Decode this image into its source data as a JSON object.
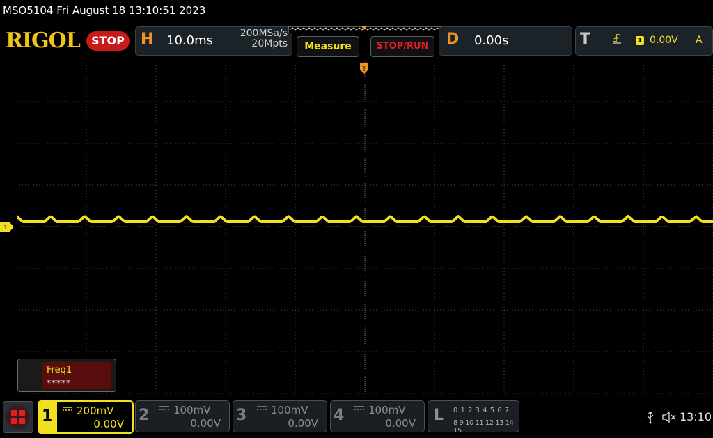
{
  "titlebar": {
    "text": "MSO5104  Fri August 18 13:10:51 2023"
  },
  "header": {
    "logo": "RIGOL",
    "run_state": "STOP",
    "horizontal": {
      "letter": "H",
      "timebase": "10.0ms",
      "sample_rate": "200MSa/s",
      "memory_depth": "20Mpts"
    },
    "measure_button": "Measure",
    "stoprun_button": "STOP/RUN",
    "delay": {
      "letter": "D",
      "value": "0.00s"
    },
    "trigger": {
      "letter": "T",
      "channel": "1",
      "level": "0.00V",
      "mode": "A"
    }
  },
  "waveform": {
    "channel_marker": "1",
    "color": "#f0e020",
    "bumps_per_screen": 21
  },
  "measurement": {
    "label": "Freq1",
    "value": "*****"
  },
  "channels": [
    {
      "num": "1",
      "scale": "200mV",
      "offset": "0.00V",
      "active": true
    },
    {
      "num": "2",
      "scale": "100mV",
      "offset": "0.00V",
      "active": false
    },
    {
      "num": "3",
      "scale": "100mV",
      "offset": "0.00V",
      "active": false
    },
    {
      "num": "4",
      "scale": "100mV",
      "offset": "0.00V",
      "active": false
    }
  ],
  "logic": {
    "letter": "L",
    "row1": "0 1 2 3   4 5 6 7",
    "row2": "8 9 10 11 12 13 14 15"
  },
  "status": {
    "time": "13:10"
  },
  "colors": {
    "accent": "#f29421",
    "channel1": "#f0e020",
    "stop": "#c71a1a",
    "grid": "#555555"
  }
}
